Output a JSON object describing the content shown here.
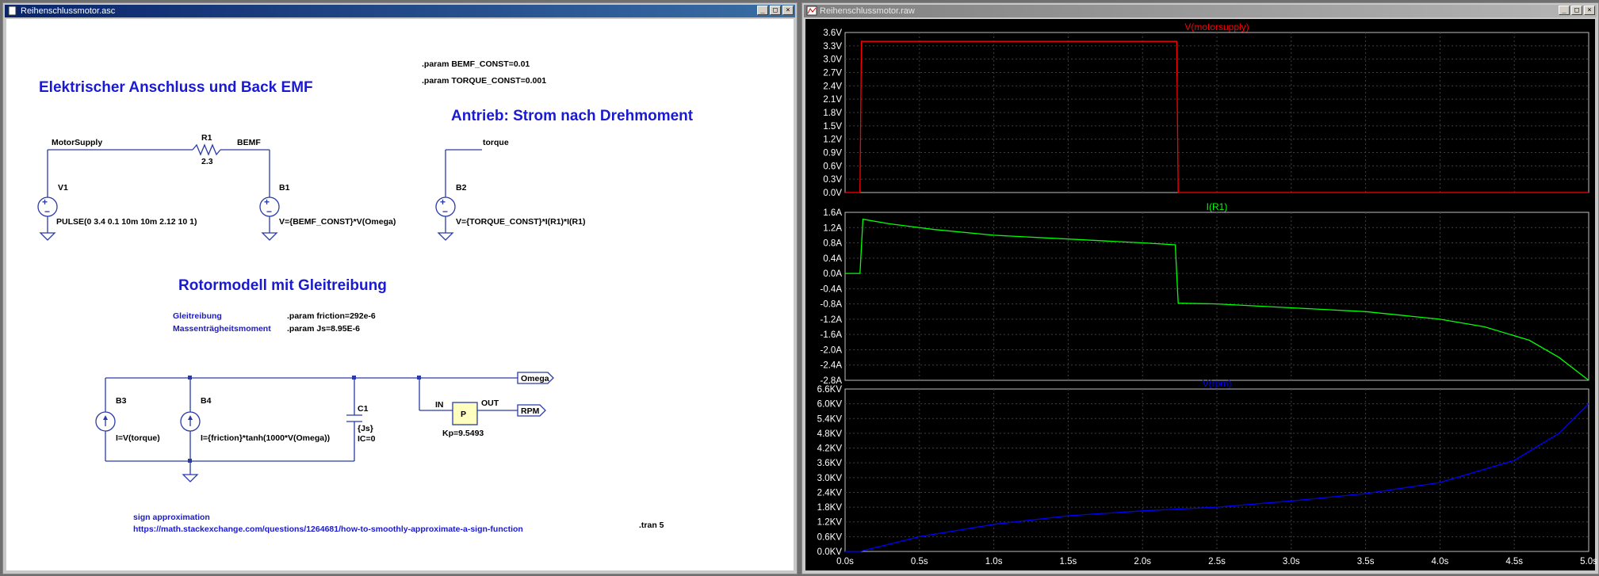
{
  "schematic_window": {
    "title": "Reihenschlussmotor.asc",
    "directives": {
      "bemf_const": ".param BEMF_CONST=0.01",
      "torque_const": ".param TORQUE_CONST=0.001",
      "friction": ".param friction=292e-6",
      "js": ".param Js=8.95E-6",
      "tran": ".tran 5"
    },
    "headings": {
      "electrical": "Elektrischer Anschluss und Back EMF",
      "drive": "Antrieb: Strom nach Drehmoment",
      "rotor": "Rotormodell mit Gleitreibung"
    },
    "labels": {
      "gleitreibung": "Gleitreibung",
      "massentraegheit": "Massenträgheitsmoment",
      "sign_approx": "sign approximation",
      "url": "https://math.stackexchange.com/questions/1264681/how-to-smoothly-approximate-a-sign-function"
    },
    "nets": {
      "motorsupply": "MotorSupply",
      "bemf": "BEMF",
      "torque": "torque",
      "omega": "Omega",
      "rpm": "RPM"
    },
    "components": {
      "r1": {
        "name": "R1",
        "value": "2.3"
      },
      "v1": {
        "name": "V1",
        "value": "PULSE(0 3.4 0.1 10m 10m 2.12 10 1)"
      },
      "b1": {
        "name": "B1",
        "value": "V={BEMF_CONST}*V(Omega)"
      },
      "b2": {
        "name": "B2",
        "value": "V={TORQUE_CONST}*I(R1)*I(R1)"
      },
      "b3": {
        "name": "B3",
        "value": "I=V(torque)"
      },
      "b4": {
        "name": "B4",
        "value": "I={friction}*tanh(1000*V(Omega))"
      },
      "c1": {
        "name": "C1",
        "value": "{Js}",
        "ic": "IC=0"
      },
      "p": {
        "label": "P",
        "in": "IN",
        "out": "OUT",
        "gain": "Kp=9.5493"
      }
    }
  },
  "plot_window": {
    "title": "Reihenschlussmotor.raw",
    "colors": {
      "motorsupply": "#ff0000",
      "ir1": "#00ff00",
      "rpm": "#0000ff",
      "axis_text": "#ffffff",
      "grid": "#404040"
    },
    "chart_data": [
      {
        "type": "line",
        "title": "V(motorsupply)",
        "ylim": [
          0,
          3.6
        ],
        "yticks": [
          "3.6V",
          "3.3V",
          "3.0V",
          "2.7V",
          "2.4V",
          "2.1V",
          "1.8V",
          "1.5V",
          "1.2V",
          "0.9V",
          "0.6V",
          "0.3V",
          "0.0V"
        ],
        "series": [
          {
            "name": "V(motorsupply)",
            "x": [
              0,
              0.1,
              0.11,
              2.23,
              2.24,
              5.0
            ],
            "y": [
              0,
              0,
              3.4,
              3.4,
              0,
              0
            ]
          }
        ]
      },
      {
        "type": "line",
        "title": "I(R1)",
        "ylim": [
          -2.8,
          1.6
        ],
        "yticks": [
          "1.6A",
          "1.2A",
          "0.8A",
          "0.4A",
          "0.0A",
          "-0.4A",
          "-0.8A",
          "-1.2A",
          "-1.6A",
          "-2.0A",
          "-2.4A",
          "-2.8A"
        ],
        "series": [
          {
            "name": "I(R1)",
            "x": [
              0,
              0.1,
              0.12,
              0.3,
              0.6,
              1.0,
              1.5,
              2.0,
              2.22,
              2.24,
              2.5,
              3.0,
              3.5,
              4.0,
              4.3,
              4.6,
              4.8,
              5.0
            ],
            "y": [
              0,
              0,
              1.42,
              1.3,
              1.15,
              1.0,
              0.9,
              0.8,
              0.75,
              -0.78,
              -0.8,
              -0.9,
              -1.0,
              -1.2,
              -1.4,
              -1.75,
              -2.2,
              -2.8
            ]
          }
        ]
      },
      {
        "type": "line",
        "title": "V(rpm)",
        "ylim": [
          0,
          6.6
        ],
        "yticks": [
          "6.6KV",
          "6.0KV",
          "5.4KV",
          "4.8KV",
          "4.2KV",
          "3.6KV",
          "3.0KV",
          "2.4KV",
          "1.8KV",
          "1.2KV",
          "0.6KV",
          "0.0KV"
        ],
        "series": [
          {
            "name": "V(rpm)",
            "x": [
              0,
              0.1,
              0.5,
              1.0,
              1.5,
              2.0,
              2.23,
              2.5,
              3.0,
              3.5,
              4.0,
              4.5,
              4.8,
              5.0
            ],
            "y": [
              0,
              0,
              0.6,
              1.1,
              1.45,
              1.65,
              1.72,
              1.8,
              2.05,
              2.35,
              2.8,
              3.7,
              4.8,
              6.0
            ]
          }
        ]
      }
    ],
    "xaxis": {
      "ticks": [
        "0.0s",
        "0.5s",
        "1.0s",
        "1.5s",
        "2.0s",
        "2.5s",
        "3.0s",
        "3.5s",
        "4.0s",
        "4.5s",
        "5.0s"
      ],
      "xlim": [
        0,
        5
      ]
    }
  }
}
